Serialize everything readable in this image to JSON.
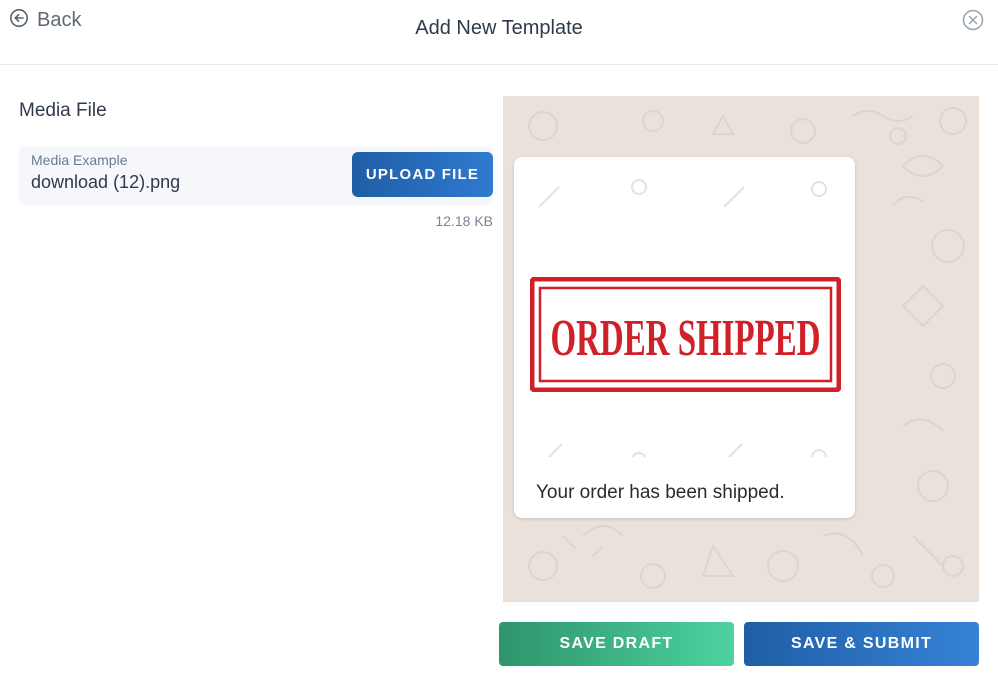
{
  "header": {
    "back_label": "Back",
    "title": "Add New Template"
  },
  "media": {
    "section_title": "Media File",
    "field_label": "Media Example",
    "file_name": "download (12).png",
    "upload_label": "UPLOAD FILE",
    "file_size": "12.18 KB"
  },
  "preview": {
    "stamp_text": "ORDER SHIPPED",
    "message_text": "Your order has been shipped."
  },
  "actions": {
    "save_draft_label": "SAVE DRAFT",
    "save_submit_label": "SAVE & SUBMIT"
  },
  "colors": {
    "primary": "#1f5ea6",
    "success": "#2e946b",
    "stamp_red": "#d0212a",
    "chat_background": "#e9e1da"
  },
  "icons": {
    "back": "arrow-left-circle-icon",
    "close": "close-circle-icon"
  }
}
